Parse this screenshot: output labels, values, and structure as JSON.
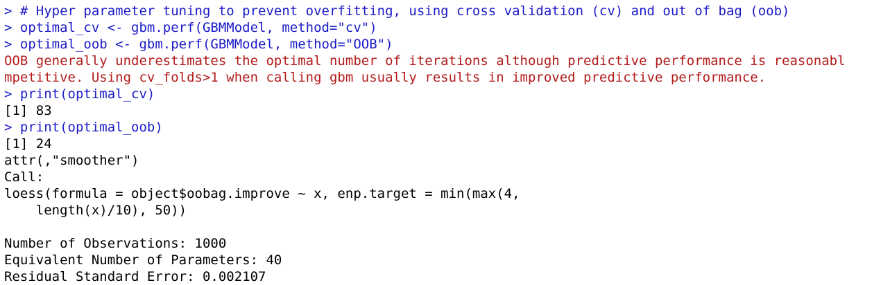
{
  "console": {
    "lines": [
      {
        "kind": "input",
        "text": "> # Hyper parameter tuning to prevent overfitting, using cross validation (cv) and out of bag (oob)"
      },
      {
        "kind": "input",
        "text": "> optimal_cv <- gbm.perf(GBMModel, method=\"cv\")"
      },
      {
        "kind": "input",
        "text": "> optimal_oob <- gbm.perf(GBMModel, method=\"OOB\")"
      },
      {
        "kind": "warning",
        "text": "OOB generally underestimates the optimal number of iterations although predictive performance is reasonabl"
      },
      {
        "kind": "warning",
        "text": "mpetitive. Using cv_folds>1 when calling gbm usually results in improved predictive performance."
      },
      {
        "kind": "input",
        "text": "> print(optimal_cv)"
      },
      {
        "kind": "output",
        "text": "[1] 83"
      },
      {
        "kind": "input",
        "text": "> print(optimal_oob)"
      },
      {
        "kind": "output",
        "text": "[1] 24"
      },
      {
        "kind": "output",
        "text": "attr(,\"smoother\")"
      },
      {
        "kind": "output",
        "text": "Call:"
      },
      {
        "kind": "output",
        "text": "loess(formula = object$oobag.improve ~ x, enp.target = min(max(4,"
      },
      {
        "kind": "output",
        "text": "    length(x)/10), 50))"
      },
      {
        "kind": "output",
        "text": ""
      },
      {
        "kind": "output",
        "text": "Number of Observations: 1000"
      },
      {
        "kind": "output",
        "text": "Equivalent Number of Parameters: 40"
      },
      {
        "kind": "output",
        "text": "Residual Standard Error: 0.002107"
      }
    ]
  },
  "colors": {
    "input": "#1a1ac8",
    "output": "#000000",
    "warning": "#b31b1b",
    "background": "#ffffff"
  }
}
